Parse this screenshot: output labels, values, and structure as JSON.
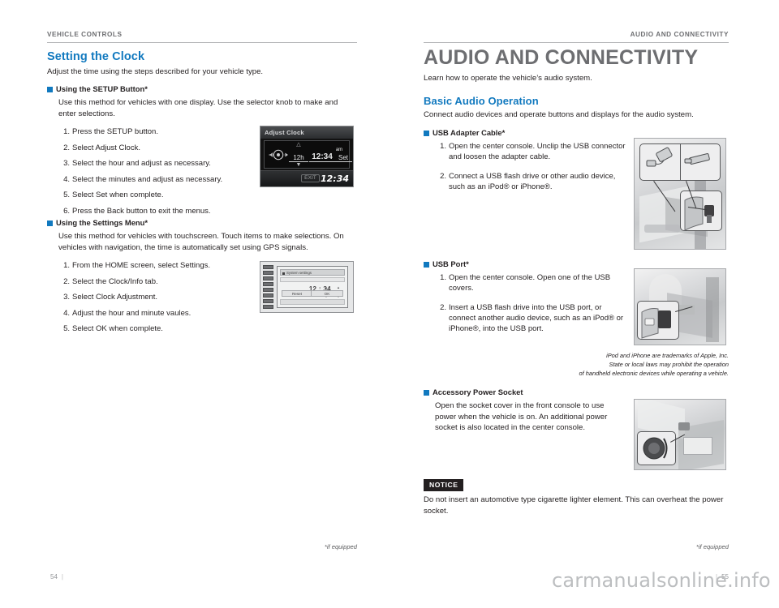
{
  "document": {
    "watermark": "carmanualsonline.info"
  },
  "left_page": {
    "running_head": "VEHICLE CONTROLS",
    "section_title": "Setting the Clock",
    "section_intro": "Adjust the time using the steps described for your vehicle type.",
    "blocks": [
      {
        "subhead": "Using the SETUP Button*",
        "body": "Use this method for vehicles with one display. Use the selector knob to make and enter selections.",
        "steps": [
          "Press the SETUP button.",
          "Select Adjust Clock.",
          "Select the hour and adjust as necessary.",
          "Select the minutes and adjust as necessary.",
          "Select Set when complete.",
          "Press the Back button to exit the menus."
        ]
      },
      {
        "subhead": "Using the Settings Menu*",
        "body": "Use this method for vehicles with touchscreen. Touch items to make selections. On vehicles with navigation, the time is automatically set using GPS signals.",
        "steps": [
          "From the HOME screen, select Settings.",
          "Select the Clock/Info tab.",
          "Select Clock Adjustment.",
          "Adjust the hour and minute vaules.",
          "Select OK when complete."
        ]
      }
    ],
    "clock_display": {
      "title": "Adjust Clock",
      "hour_field": "12h",
      "time_field": "12:34",
      "meridiem": "am",
      "set_label": "Set",
      "exit_label": "EXIT",
      "clock_readout": "12:34"
    },
    "nav_display": {
      "header": "System settings",
      "time": "12 : 34",
      "meridiem": "am",
      "reset_label": "Reset",
      "ok_label": "OK"
    },
    "if_equipped": "*if equipped",
    "folio": "54"
  },
  "right_page": {
    "running_head": "AUDIO AND CONNECTIVITY",
    "chapter_title": "AUDIO AND CONNECTIVITY",
    "chapter_intro": "Learn how to operate the vehicle’s audio system.",
    "section_title": "Basic Audio Operation",
    "section_intro": "Connect audio devices and operate buttons and displays for the audio system.",
    "blocks": [
      {
        "subhead": "USB Adapter Cable*",
        "steps": [
          "Open the center console. Unclip the USB connector and loosen the adapter cable.",
          "Connect a USB flash drive or other audio device, such as an iPod® or iPhone®."
        ]
      },
      {
        "subhead": "USB Port*",
        "steps": [
          "Open the center console. Open one of the USB covers.",
          "Insert a USB flash drive into the USB port, or connect another audio device, such as an iPod® or iPhone®, into the USB port."
        ]
      }
    ],
    "trademark_lines": [
      "iPod and iPhone are trademarks of Apple, Inc.",
      "State or local laws may prohibit the operation",
      "of handheld electronic devices while operating a vehicle."
    ],
    "accessory": {
      "subhead": "Accessory Power Socket",
      "body": "Open the socket cover in the front console to use power when the vehicle is on. An additional power socket is also located in the center console."
    },
    "notice": {
      "tag": "NOTICE",
      "body": "Do not insert an automotive type cigarette lighter element. This can overheat the power socket."
    },
    "if_equipped": "*if equipped",
    "folio": "55"
  },
  "colors": {
    "accent_blue": "#1179bf",
    "head_gray": "#6d6e71",
    "body_black": "#231f20"
  }
}
